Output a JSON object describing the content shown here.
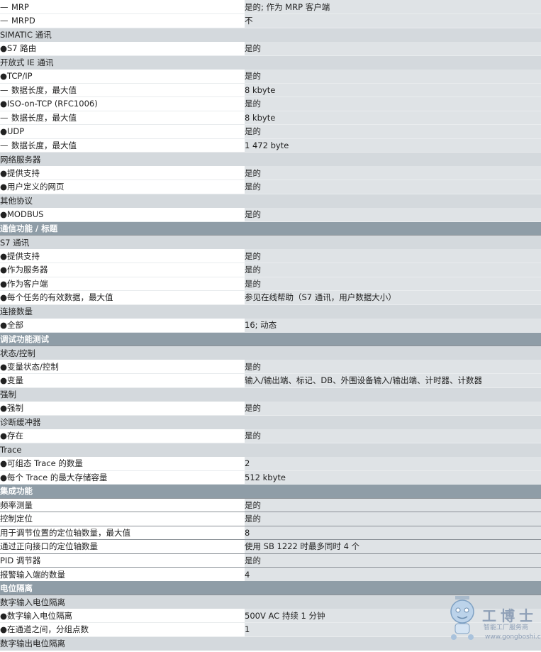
{
  "rows": [
    {
      "type": "item",
      "level": "dash",
      "label": "MRP",
      "value": "是的; 作为 MRP 客户端"
    },
    {
      "type": "item",
      "level": "dash",
      "label": "MRPD",
      "value": "不"
    },
    {
      "type": "sub",
      "label": "SIMATIC 通讯",
      "value": ""
    },
    {
      "type": "item",
      "level": "bullet",
      "label": "S7 路由",
      "value": "是的"
    },
    {
      "type": "sub",
      "label": "开放式 IE 通讯",
      "value": ""
    },
    {
      "type": "item",
      "level": "bullet",
      "label": "TCP/IP",
      "value": "是的"
    },
    {
      "type": "item",
      "level": "dash",
      "label": "数据长度，最大值",
      "value": "8 kbyte"
    },
    {
      "type": "item",
      "level": "bullet",
      "label": "ISO-on-TCP (RFC1006)",
      "value": "是的"
    },
    {
      "type": "item",
      "level": "dash",
      "label": "数据长度，最大值",
      "value": "8 kbyte"
    },
    {
      "type": "item",
      "level": "bullet",
      "label": "UDP",
      "value": "是的"
    },
    {
      "type": "item",
      "level": "dash",
      "label": "数据长度，最大值",
      "value": "1 472 byte"
    },
    {
      "type": "sub",
      "label": "网络服务器",
      "value": ""
    },
    {
      "type": "item",
      "level": "bullet",
      "label": "提供支持",
      "value": "是的"
    },
    {
      "type": "item",
      "level": "bullet",
      "label": "用户定义的网页",
      "value": "是的"
    },
    {
      "type": "sub",
      "label": "其他协议",
      "value": ""
    },
    {
      "type": "item",
      "level": "bullet",
      "label": "MODBUS",
      "value": "是的"
    },
    {
      "type": "section",
      "label": "通信功能 / 标题"
    },
    {
      "type": "sub",
      "label": "S7 通讯",
      "value": ""
    },
    {
      "type": "item",
      "level": "bullet",
      "label": "提供支持",
      "value": "是的"
    },
    {
      "type": "item",
      "level": "bullet",
      "label": "作为服务器",
      "value": "是的"
    },
    {
      "type": "item",
      "level": "bullet",
      "label": "作为客户端",
      "value": "是的"
    },
    {
      "type": "item",
      "level": "bullet",
      "label": "每个任务的有效数据，最大值",
      "value": "参见在线帮助（S7 通讯，用户数据大小）"
    },
    {
      "type": "sub",
      "label": "连接数量",
      "value": ""
    },
    {
      "type": "item",
      "level": "bullet",
      "label": "全部",
      "value": "16; 动态"
    },
    {
      "type": "section",
      "label": "调试功能测试"
    },
    {
      "type": "sub",
      "label": "状态/控制",
      "value": ""
    },
    {
      "type": "item",
      "level": "bullet",
      "label": "变量状态/控制",
      "value": "是的"
    },
    {
      "type": "item",
      "level": "bullet",
      "label": "变量",
      "value": "输入/输出端、标记、DB、外围设备输入/输出端、计时器、计数器"
    },
    {
      "type": "sub",
      "label": "强制",
      "value": ""
    },
    {
      "type": "item",
      "level": "bullet",
      "label": "强制",
      "value": "是的"
    },
    {
      "type": "sub",
      "label": "诊断缓冲器",
      "value": ""
    },
    {
      "type": "item",
      "level": "bullet",
      "label": "存在",
      "value": "是的"
    },
    {
      "type": "sub",
      "label": "Trace",
      "value": ""
    },
    {
      "type": "item",
      "level": "bullet",
      "label": "可组态 Trace 的数量",
      "value": "2"
    },
    {
      "type": "item",
      "level": "bullet",
      "label": "每个 Trace 的最大存储容量",
      "value": "512 kbyte"
    },
    {
      "type": "section",
      "label": "集成功能"
    },
    {
      "type": "plain",
      "label": "频率测量",
      "value": "是的"
    },
    {
      "type": "plain",
      "label": "控制定位",
      "value": "是的"
    },
    {
      "type": "plain",
      "label": "用于调节位置的定位轴数量，最大值",
      "value": "8"
    },
    {
      "type": "plain",
      "label": "通过正向接口的定位轴数量",
      "value": "使用 SB 1222 时最多同时 4 个"
    },
    {
      "type": "plain",
      "label": "PID 调节器",
      "value": "是的"
    },
    {
      "type": "plain",
      "label": "报警输入端的数量",
      "value": "4"
    },
    {
      "type": "section",
      "label": "电位隔离"
    },
    {
      "type": "sub",
      "label": "数字输入电位隔离",
      "value": ""
    },
    {
      "type": "item",
      "level": "bullet",
      "label": "数字输入电位隔离",
      "value": "500V AC 持续 1 分钟"
    },
    {
      "type": "item",
      "level": "bullet",
      "label": "在通道之间，分组点数",
      "value": "1"
    },
    {
      "type": "sub",
      "label": "数字输出电位隔离",
      "value": ""
    }
  ],
  "marks": {
    "bullet": "●",
    "dash": "—"
  },
  "watermark": {
    "brand": "工博士",
    "tagline": "智能工厂服务商",
    "url": "www.gongboshi.com"
  },
  "colors": {
    "section_bg": "#8f9da7",
    "value_bg": "#dfe3e6",
    "sub_bg": "#d4d9dd"
  }
}
